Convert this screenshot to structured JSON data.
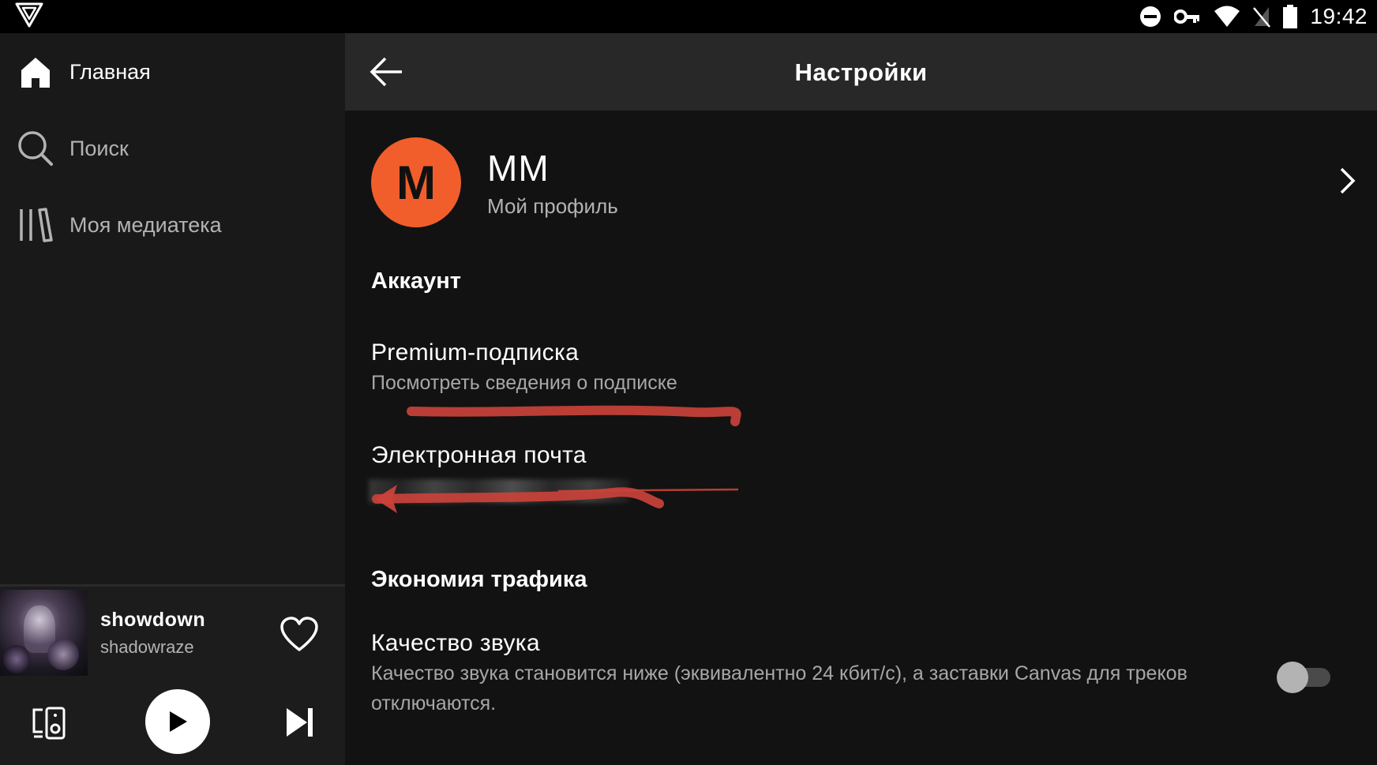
{
  "status_bar": {
    "time": "19:42"
  },
  "sidebar": {
    "items": [
      {
        "label": "Главная",
        "icon": "home-icon",
        "active": true
      },
      {
        "label": "Поиск",
        "icon": "search-icon",
        "active": false
      },
      {
        "label": "Моя медиатека",
        "icon": "library-icon",
        "active": false
      }
    ]
  },
  "player": {
    "track_title": "showdown",
    "artist": "shadowraze"
  },
  "header": {
    "title": "Настройки"
  },
  "profile": {
    "initial": "M",
    "name": "MM",
    "subtitle": "Мой профиль"
  },
  "sections": {
    "account": {
      "header": "Аккаунт",
      "premium_title": "Premium-подписка",
      "premium_subtitle": "Посмотреть сведения о подписке",
      "email_title": "Электронная почта"
    },
    "data_saver": {
      "header": "Экономия трафика",
      "audio_quality_title": "Качество звука",
      "audio_quality_description": "Качество звука становится ниже (эквивалентно 24 кбит/с), а заставки Canvas для треков отключаются.",
      "toggle_on": false
    }
  },
  "colors": {
    "accent": "#F15E2C",
    "annotation": "#D9473C",
    "background": "#121212",
    "sidebar": "#191919",
    "topbar": "#282828"
  }
}
